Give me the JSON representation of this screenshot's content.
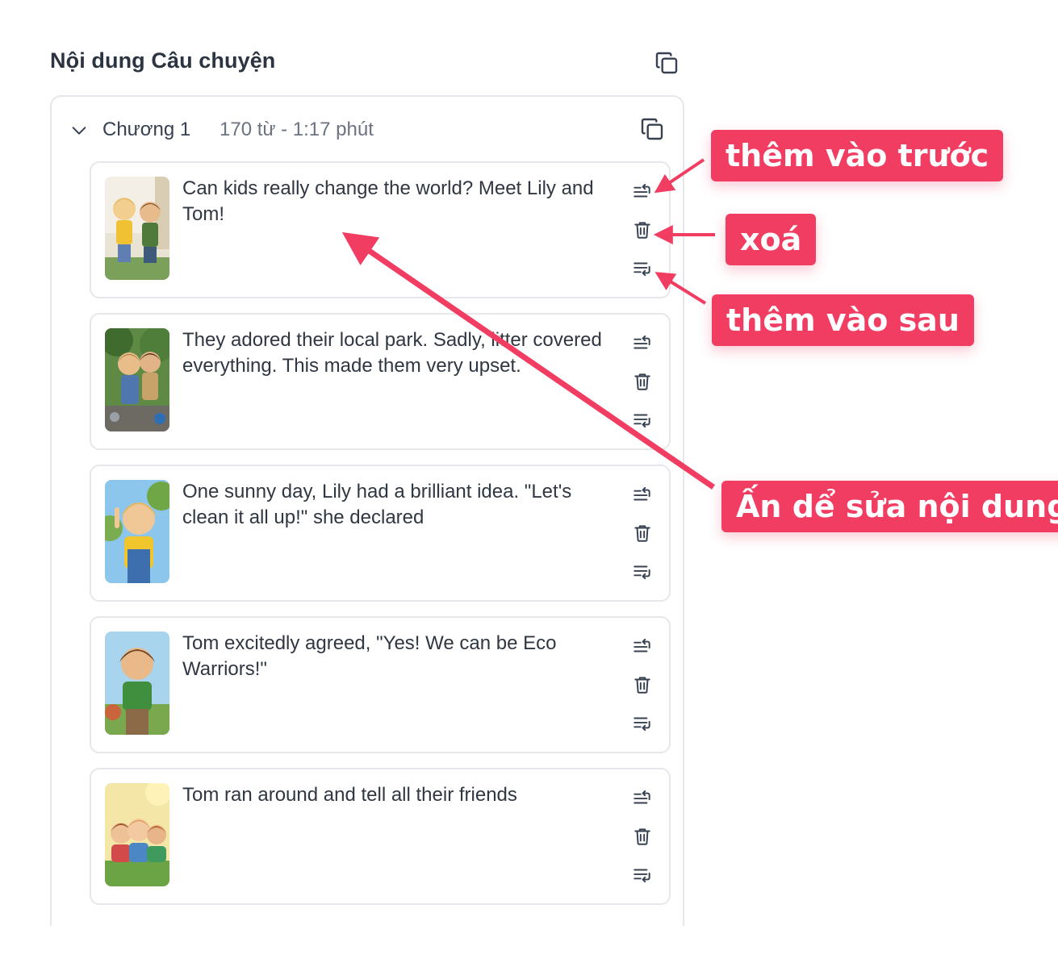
{
  "section": {
    "title": "Nội dung Câu chuyện"
  },
  "chapter": {
    "name": "Chương 1",
    "meta": "170 từ - 1:17 phút"
  },
  "paragraphs": [
    {
      "text": "Can kids really change the world? Meet Lily and Tom!"
    },
    {
      "text": "They adored their local park. Sadly, litter covered everything. This made them very upset."
    },
    {
      "text": "One sunny day, Lily had a brilliant idea. \"Let's clean it all up!\" she declared"
    },
    {
      "text": "Tom excitedly agreed, \"Yes! We can be Eco Warriors!\""
    },
    {
      "text": "Tom ran around and tell all their friends"
    }
  ],
  "annotations": {
    "insert_before": "thêm vào trước",
    "delete": "xoá",
    "insert_after": "thêm vào sau",
    "edit": "Ấn dể sửa nội dung"
  },
  "icons": {
    "copy": "copy-icon",
    "chevron": "chevron-down-icon",
    "insert_before": "insert-before-icon",
    "delete": "trash-icon",
    "insert_after": "insert-after-icon"
  },
  "colors": {
    "accent": "#f23d63",
    "border": "#e5e7eb",
    "text": "#2f3742",
    "muted": "#6b7280"
  }
}
